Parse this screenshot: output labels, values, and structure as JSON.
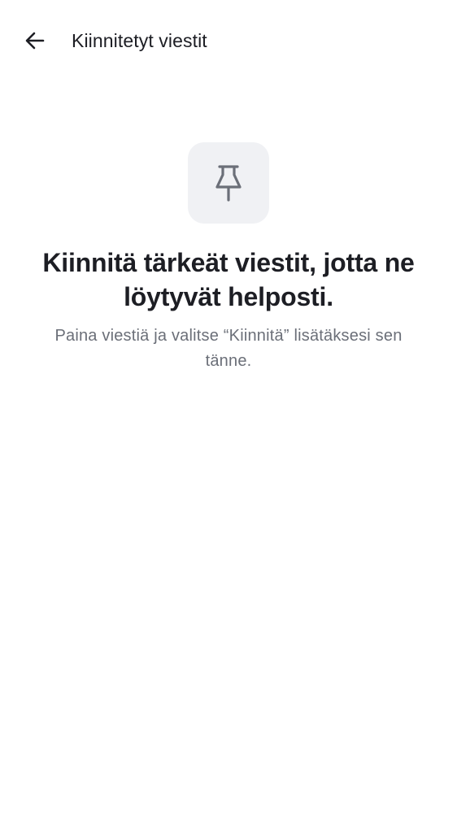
{
  "header": {
    "back_icon": "arrow-left-icon",
    "title": "Kiinnitetyt viestit"
  },
  "empty_state": {
    "icon": "pushpin-icon",
    "headline": "Kiinnitä tärkeät viestit, jotta ne löytyvät helposti.",
    "hint": "Paina viestiä ja valitse “Kiinnitä” lisätäksesi sen tänne."
  },
  "colors": {
    "background": "#ffffff",
    "title_text": "#1d1e24",
    "hint_text": "#6b6f78",
    "icon_tile": "#f0f1f4",
    "icon_stroke": "#6b6f78"
  }
}
